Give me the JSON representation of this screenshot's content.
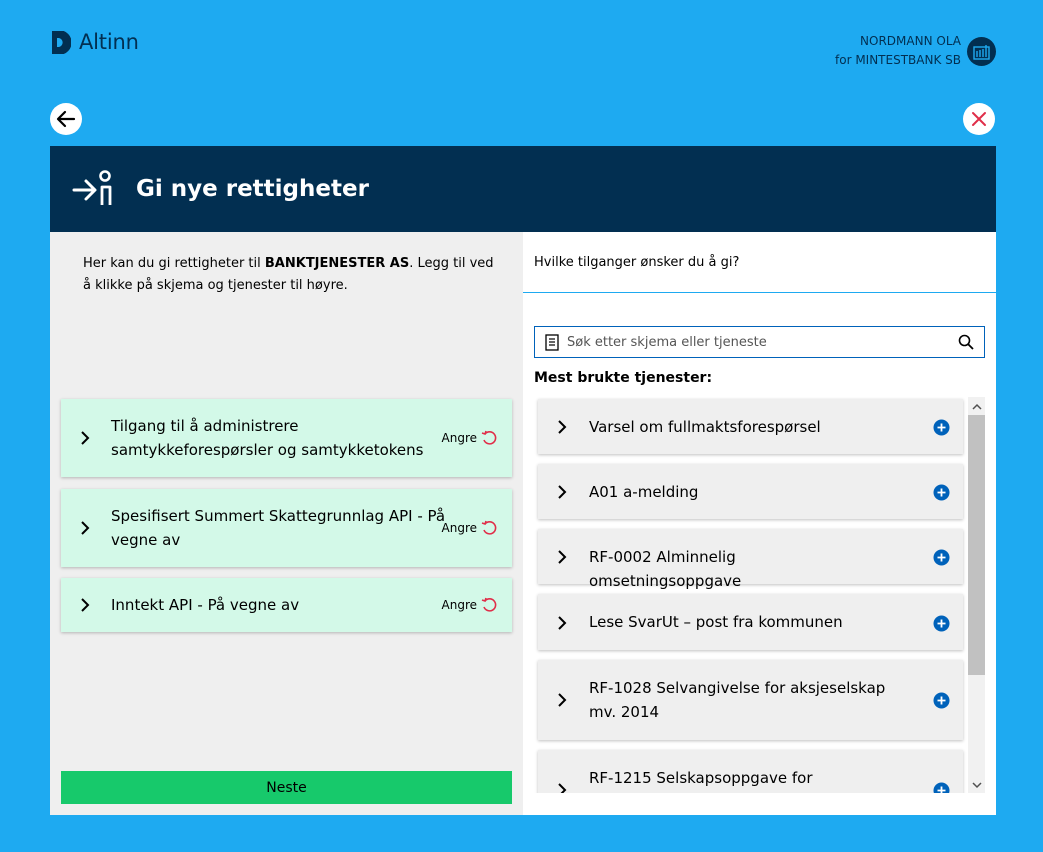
{
  "header": {
    "logo_text": "Altinn",
    "user_name": "NORDMANN OLA",
    "user_org": "for MINTESTBANK SB"
  },
  "icons": {
    "back": "arrow-left-icon",
    "close": "close-icon",
    "avatar": "building-icon",
    "header": "person-arrow-icon",
    "chevron": "chevron-right-icon",
    "undo": "undo-icon",
    "add": "plus-circle-icon",
    "search_doc": "document-icon",
    "search": "search-icon"
  },
  "colors": {
    "background": "#1eaaf1",
    "header": "#022f51",
    "selected_card": "#d3f9e8",
    "next_button": "#17c96b",
    "plus": "#0062ba",
    "close": "#e02e49"
  },
  "modal": {
    "title": "Gi nye rettigheter",
    "intro_prefix": "Her kan du gi rettigheter til ",
    "intro_org": "BANKTJENESTER AS",
    "intro_suffix": ". Legg til ved å klikke på skjema og tjenester til høyre.",
    "selected": [
      {
        "label": "Tilgang til å administrere samtykkeforespørsler og samtykketokens",
        "undo": "Angre"
      },
      {
        "label": "Spesifisert Summert Skattegrunnlag API - På vegne av",
        "undo": "Angre"
      },
      {
        "label": "Inntekt API - På vegne av",
        "undo": "Angre"
      }
    ],
    "next_label": "Neste",
    "question": "Hvilke tilganger ønsker du å gi?",
    "search_placeholder": "Søk etter skjema eller tjeneste",
    "most_used_heading": "Mest brukte tjenester:",
    "services": [
      {
        "label": "Varsel om fullmaktsforespørsel"
      },
      {
        "label": "A01 a-melding"
      },
      {
        "label": "RF-0002 Alminnelig omsetningsoppgave"
      },
      {
        "label": "Lese SvarUt – post fra kommunen"
      },
      {
        "label": "RF-1028 Selvangivelse for aksjeselskap mv. 2014"
      },
      {
        "label": "RF-1215 Selskapsoppgave for"
      }
    ]
  }
}
